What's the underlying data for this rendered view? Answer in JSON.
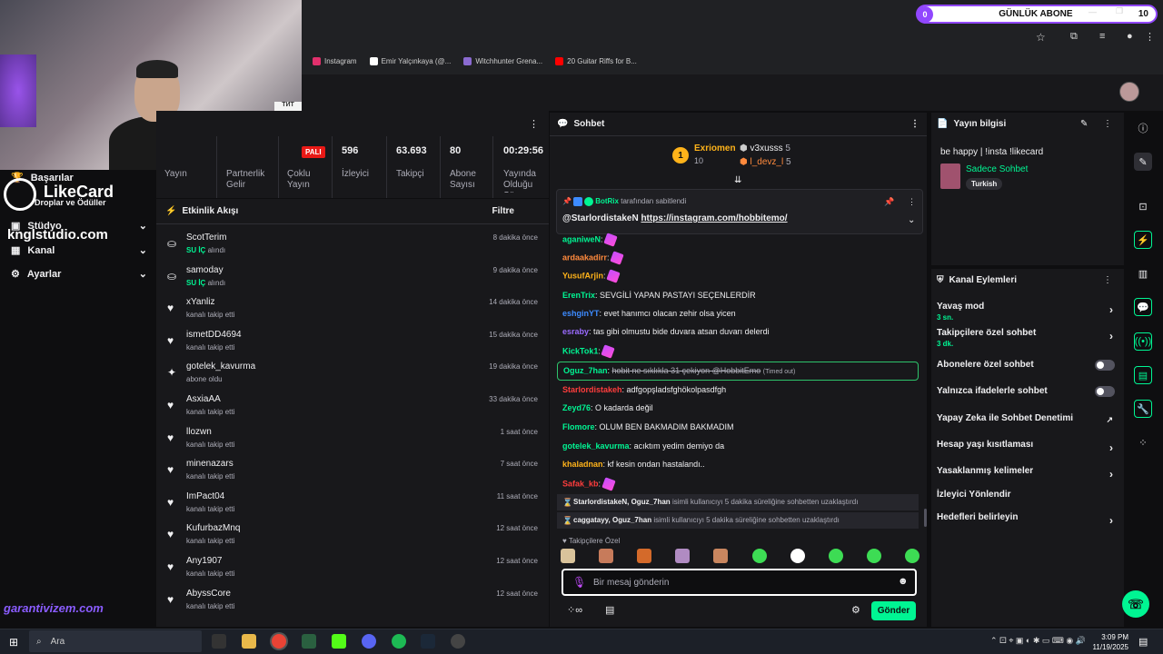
{
  "overlay": {
    "abone_count": "0",
    "abone_label": "GÜNLÜK ABONE",
    "abone_goal": "10",
    "likecard": "LikeCard",
    "likecard_sub": "Droplar ve Ödüller",
    "kngi": "knglstudio.com",
    "garanti": "garantivizem.com",
    "sign": "ТИТ"
  },
  "bookmarks": [
    {
      "label": "Instagram",
      "color": "#e1306c"
    },
    {
      "label": "Emir Yalçınkaya (@...",
      "color": "#ffffff"
    },
    {
      "label": "Witchhunter Grena...",
      "color": "#8a6ad0"
    },
    {
      "label": "20 Guitar Riffs for B...",
      "color": "#ff0000"
    }
  ],
  "leftnav": {
    "items": [
      {
        "label": "Başarılar",
        "icon": "trophy-icon"
      },
      {
        "label": "Stüdyo",
        "icon": "studio-icon"
      },
      {
        "label": "Kanal",
        "icon": "channel-icon"
      },
      {
        "label": "Ayarlar",
        "icon": "gear-icon"
      }
    ]
  },
  "stats": {
    "live": "PALI",
    "items": [
      {
        "value": "",
        "label": "Yayın"
      },
      {
        "value": "",
        "label": "Partnerlik Gelir"
      },
      {
        "value": "",
        "label": "Çoklu Yayın"
      },
      {
        "value": "596",
        "label": "İzleyici"
      },
      {
        "value": "63.693",
        "label": "Takipçi"
      },
      {
        "value": "80",
        "label": "Abone Sayısı"
      },
      {
        "value": "00:29:56",
        "label": "Yayında Olduğu Süre"
      }
    ]
  },
  "feed": {
    "title": "Etkinlik Akışı",
    "filter": "Filtre",
    "items": [
      {
        "name": "ScotTerim",
        "badge": "SU İÇ",
        "action": "alındı",
        "time": "8 dakika önce",
        "icon": "drop-icon"
      },
      {
        "name": "samoday",
        "badge": "SU İÇ",
        "action": "alındı",
        "time": "9 dakika önce",
        "icon": "drop-icon"
      },
      {
        "name": "xYanliz",
        "badge": "",
        "action": "kanalı takip etti",
        "time": "14 dakika önce",
        "icon": "heart-icon"
      },
      {
        "name": "ismetDD4694",
        "badge": "",
        "action": "kanalı takip etti",
        "time": "15 dakika önce",
        "icon": "heart-icon"
      },
      {
        "name": "gotelek_kavurma",
        "badge": "",
        "action": "abone oldu",
        "time": "19 dakika önce",
        "icon": "star-icon"
      },
      {
        "name": "AsxiaAA",
        "badge": "",
        "action": "kanalı takip etti",
        "time": "33 dakika önce",
        "icon": "heart-icon"
      },
      {
        "name": "llozwn",
        "badge": "",
        "action": "kanalı takip etti",
        "time": "1 saat önce",
        "icon": "heart-icon"
      },
      {
        "name": "minenazars",
        "badge": "",
        "action": "kanalı takip etti",
        "time": "7 saat önce",
        "icon": "heart-icon"
      },
      {
        "name": "ImPact04",
        "badge": "",
        "action": "kanalı takip etti",
        "time": "11 saat önce",
        "icon": "heart-icon"
      },
      {
        "name": "KufurbazMnq",
        "badge": "",
        "action": "kanalı takip etti",
        "time": "12 saat önce",
        "icon": "heart-icon"
      },
      {
        "name": "Any1907",
        "badge": "",
        "action": "kanalı takip etti",
        "time": "12 saat önce",
        "icon": "heart-icon"
      },
      {
        "name": "AbyssCore",
        "badge": "",
        "action": "kanalı takip etti",
        "time": "12 saat önce",
        "icon": "heart-icon"
      }
    ]
  },
  "chat": {
    "title": "Sohbet",
    "leaders": {
      "first": {
        "name": "Exriomen",
        "count": "10"
      },
      "second": {
        "name": "v3xusss",
        "count": "5"
      },
      "third": {
        "name": "l_devz_l",
        "count": "5"
      }
    },
    "pinned": {
      "by_user": "BotRix",
      "by_text": "tarafından sabitlendi",
      "mention": "@StarlordistakeN",
      "link": "https://instagram.com/hobbitemo/"
    },
    "messages": [
      {
        "user": "aganiweN",
        "color": "#00f593",
        "text": "",
        "emote": true
      },
      {
        "user": "ardaakadirr",
        "color": "#ff8a3d",
        "text": "",
        "emote": true
      },
      {
        "user": "YusufArjin",
        "color": "#ffb31a",
        "text": "",
        "emote": true
      },
      {
        "user": "ErenTrix",
        "color": "#00f593",
        "text": "SEVGİLİ YAPAN PASTAYI SEÇENLERDİR",
        "emote": false
      },
      {
        "user": "eshginYT",
        "color": "#3d8bff",
        "text": "evet hanımcı olacan zehir olsa yicen",
        "emote": false
      },
      {
        "user": "esraby",
        "color": "#9b6bff",
        "text": "tas gibi olmustu bide duvara atsan duvarı delerdi",
        "emote": false
      },
      {
        "user": "KickTok1",
        "color": "#00f593",
        "text": "",
        "emote": true
      },
      {
        "user": "Oguz_7han",
        "color": "#00f593",
        "text": "hobit ne sıklıkla 31 çekiyon @HobbitEmo",
        "timed": "(Timed out)",
        "emote": false
      },
      {
        "user": "Starlordistakeh",
        "color": "#ff3d3d",
        "text": "adfgopşladsfghökolpasdfgh",
        "emote": false
      },
      {
        "user": "Zeyd76",
        "color": "#00f593",
        "text": "O kadarda değil",
        "emote": false
      },
      {
        "user": "Flomore",
        "color": "#00f593",
        "text": "OLUM BEN BAKMADIM BAKMADIM",
        "emote": false
      },
      {
        "user": "gotelek_kavurma",
        "color": "#00f593",
        "text": "acıktım yedim demiyo da",
        "emote": false
      },
      {
        "user": "khaladnan",
        "color": "#ffb31a",
        "text": "kf kesin ondan hastalandı..",
        "emote": false
      },
      {
        "user": "Safak_kb",
        "color": "#ff3d3d",
        "text": "",
        "emote": true
      }
    ],
    "system": [
      {
        "users": "StarlordistakeN, Oguz_7han",
        "text": "isimli kullanıcıyı 5 dakika süreliğine sohbetten uzaklaştırdı"
      },
      {
        "users": "caggatayy, Oguz_7han",
        "text": "isimli kullanıcıyı 5 dakika süreliğine sohbetten uzaklaştırdı"
      }
    ],
    "emote_section": "Takipçilere Özel",
    "input_placeholder": "Bir mesaj gönderin",
    "send_label": "Gönder"
  },
  "stream_info": {
    "title": "Yayın bilgisi",
    "stream_title": "be happy | !insta !likecard",
    "category": "Sadece Sohbet",
    "tag": "Turkish"
  },
  "channel_actions": {
    "title": "Kanal Eylemleri",
    "items": [
      {
        "label": "Yavaş mod",
        "sub": "3 sn.",
        "control": "chevron"
      },
      {
        "label": "Takipçilere özel sohbet",
        "sub": "3 dk.",
        "control": "chevron"
      },
      {
        "label": "Abonelere özel sohbet",
        "sub": "",
        "control": "toggle"
      },
      {
        "label": "Yalnızca ifadelerle sohbet",
        "sub": "",
        "control": "toggle"
      },
      {
        "label": "Yapay Zeka ile Sohbet Denetimi",
        "sub": "",
        "control": "external"
      },
      {
        "label": "Hesap yaşı kısıtlaması",
        "sub": "",
        "control": "chevron"
      },
      {
        "label": "Yasaklanmış kelimeler",
        "sub": "",
        "control": "chevron"
      },
      {
        "label": "İzleyici Yönlendir",
        "sub": "",
        "control": "none"
      },
      {
        "label": "Hedefleri belirleyin",
        "sub": "",
        "control": "chevron"
      }
    ]
  },
  "taskbar": {
    "search": "Ara",
    "time": "3:09 PM",
    "date": "11/19/2025"
  }
}
